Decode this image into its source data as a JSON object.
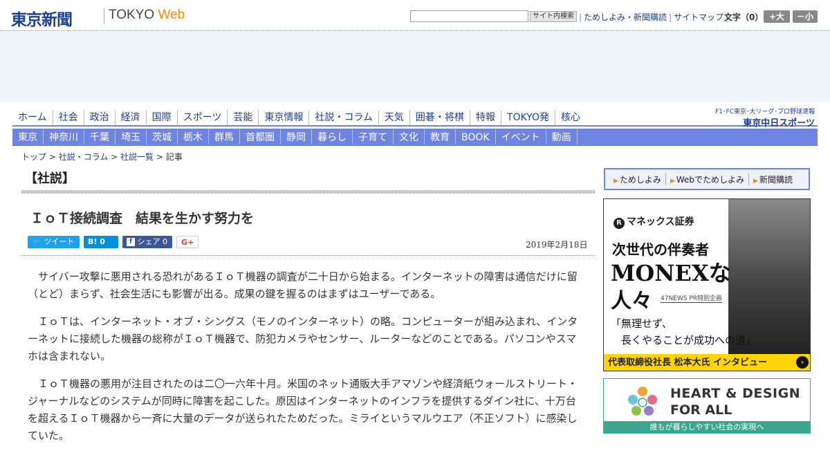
{
  "header": {
    "logo_main": "東京新聞",
    "logo_tokyo": "TOKYO",
    "logo_web": "Web",
    "search_button": "サイト内検索",
    "links": [
      "ためしよみ・新聞購読",
      "サイトマップ"
    ],
    "fontsize_label": "文字（0）",
    "font_bigger": "+大",
    "font_smaller": "－小"
  },
  "nav_main": [
    "ホーム",
    "社会",
    "政治",
    "経済",
    "国際",
    "スポーツ",
    "芸能",
    "東京情報",
    "社説・コラム",
    "天気",
    "囲碁・将棋",
    "特報",
    "TOKYO発",
    "核心"
  ],
  "chuspo": {
    "small": "F1･FC東京･大リーグ･プロ野球速報",
    "big": "東京中日スポーツ"
  },
  "nav_region": [
    "東京",
    "神奈川",
    "千葉",
    "埼玉",
    "茨城",
    "栃木",
    "群馬",
    "首都圏",
    "静岡",
    "暮らし",
    "子育て",
    "文化",
    "教育",
    "BOOK",
    "イベント",
    "動画"
  ],
  "breadcrumb": {
    "items": [
      "トップ",
      "社説・コラム",
      "社説一覧"
    ],
    "current": "記事",
    "sep": " > "
  },
  "article": {
    "section": "【社説】",
    "headline": "ＩｏＴ接続調査　結果を生かす努力を",
    "date": "2019年2月18日",
    "social": {
      "tweet": "ツイート",
      "hatena": "B! 0",
      "facebook": "シェア 0",
      "gplus": "G+"
    },
    "paragraphs": [
      "　サイバー攻撃に悪用される恐れがあるＩｏＴ機器の調査が二十日から始まる。インターネットの障害は通信だけに留（とど）まらず、社会生活にも影響が出る。成果の鍵を握るのはまずはユーザーである。",
      "　ＩｏＴは、インターネット・オブ・シングス（モノのインターネット）の略。コンピューターが組み込まれ、インターネットに接続した機器の総称がＩｏＴ機器で、防犯カメラやセンサー、ルーターなどのことである。パソコンやスマホは含まれない。",
      "　ＩｏＴ機器の悪用が注目されたのは二〇一六年十月。米国のネット通販大手アマゾンや経済紙ウォールストリート・ジャーナルなどのシステムが同時に障害を起こした。原因はインターネットのインフラを提供するダイン社に、十万台を超えるＩｏＴ機器から一斉に大量のデータが送られたためだった。ミライというマルウエア（不正ソフト）に感染していた。"
    ]
  },
  "sidebar": {
    "links": [
      "ためしよみ",
      "Webでためしよみ",
      "新聞購読"
    ],
    "monex": {
      "brand": "マネックス証券",
      "line1": "次世代の伴奏者",
      "line2": "MONEXな",
      "line3": "人々",
      "pr": "47NEWS PR特別企画",
      "quote1": "「無理せず、",
      "quote2": "　長くやることが成功への道」",
      "bar": "代表取締役社長 松本大氏 インタビュー"
    },
    "heart": {
      "line1": "HEART & DESIGN",
      "line2": "FOR ALL",
      "sub": "誰もが暮らしやすい社会の実現へ"
    }
  },
  "colors": {
    "brand_blue": "#1c3f94",
    "nav_blue": "#6f84e0",
    "accent_orange": "#f28c00",
    "monex_yellow": "#ffd400",
    "heart_green": "#3aa68c"
  }
}
